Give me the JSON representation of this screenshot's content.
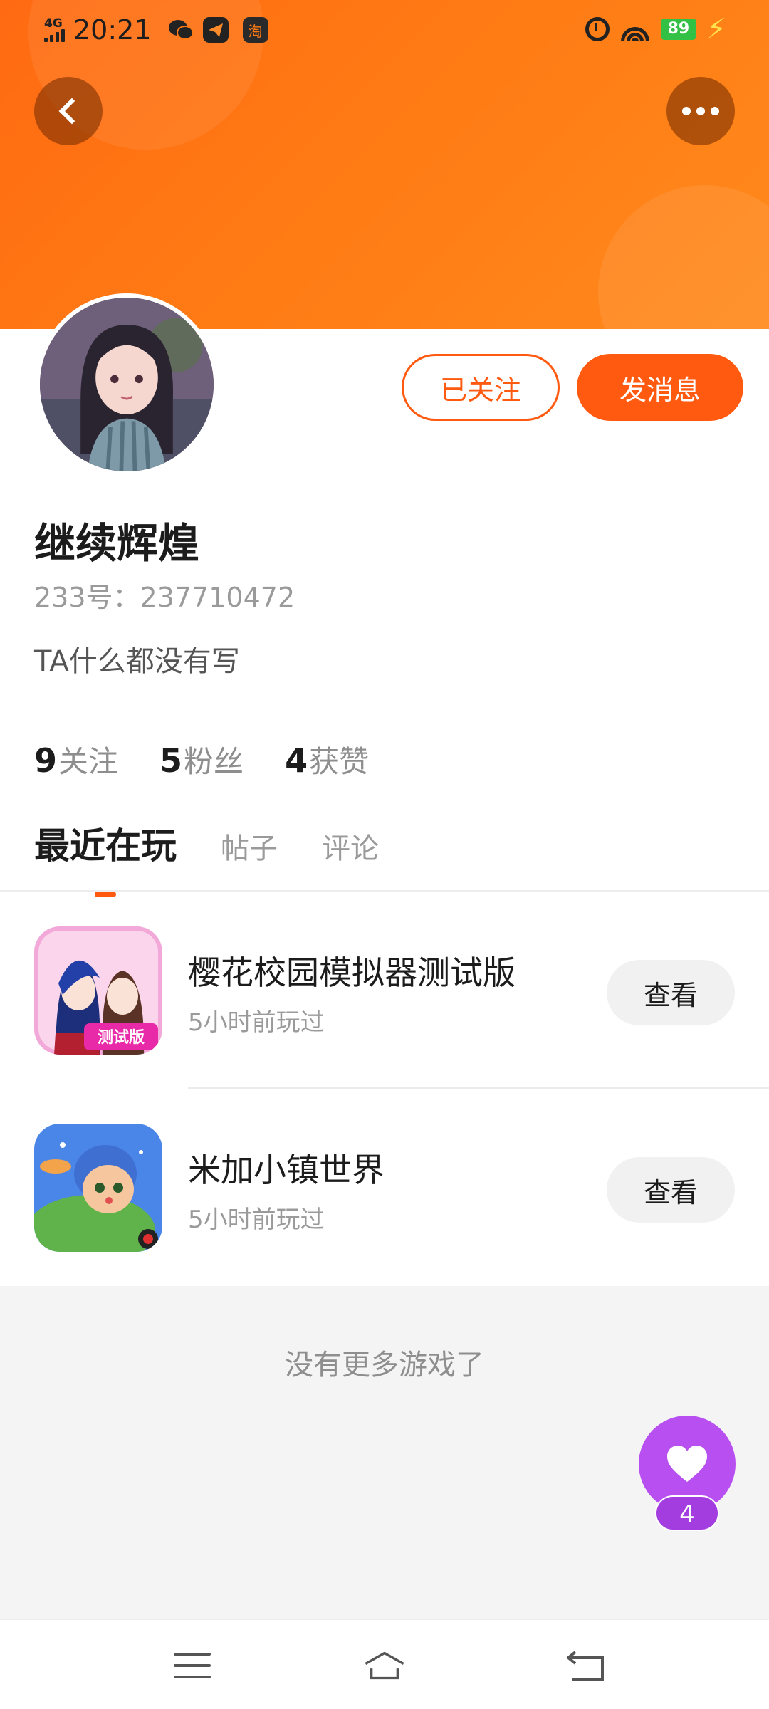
{
  "status_bar": {
    "network": "4G",
    "time": "20:21",
    "app_badge": "淘",
    "battery": "89"
  },
  "profile": {
    "follow_button": "已关注",
    "message_button": "发消息",
    "username": "继续辉煌",
    "user_id": "233号：237710472",
    "bio": "TA什么都没有写"
  },
  "stats": [
    {
      "num": "9",
      "label": "关注"
    },
    {
      "num": "5",
      "label": "粉丝"
    },
    {
      "num": "4",
      "label": "获赞"
    }
  ],
  "tabs": [
    "最近在玩",
    "帖子",
    "评论"
  ],
  "games": [
    {
      "title": "樱花校园模拟器测试版",
      "subtitle": "5小时前玩过",
      "button": "查看",
      "icon_text": "测试版"
    },
    {
      "title": "米加小镇世界",
      "subtitle": "5小时前玩过",
      "button": "查看"
    }
  ],
  "no_more_text": "没有更多游戏了",
  "like": {
    "count": "4"
  },
  "colors": {
    "accent": "#ff5a0f",
    "banner": "#ff7a14",
    "like_fab": "#b84ff0"
  }
}
